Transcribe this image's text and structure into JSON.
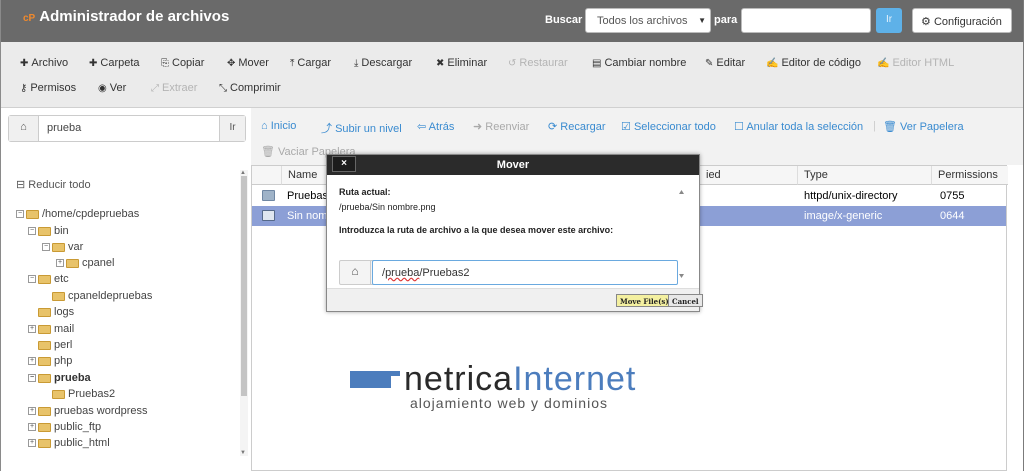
{
  "app": {
    "brand_mark": "cP",
    "title": "Administrador de archivos"
  },
  "search": {
    "label": "Buscar",
    "scope": "Todos los archivos",
    "para_label": "para",
    "query": "",
    "go": "Ir"
  },
  "settings_label": "Configuración",
  "toolbar": {
    "row1": [
      "Archivo",
      "Carpeta",
      "Copiar",
      "Mover",
      "Cargar",
      "Descargar",
      "Eliminar",
      "Restaurar",
      "Cambiar nombre",
      "Editar",
      "Editor de código",
      "Editor HTML"
    ],
    "row2": [
      "Permisos",
      "Ver",
      "Extraer",
      "Comprimir"
    ]
  },
  "left": {
    "path_value": "prueba",
    "go": "Ir",
    "collapse_all": "Reducir todo",
    "tree": [
      "/home/cpdepruebas",
      "bin",
      "var",
      "cpanel",
      "etc",
      "cpaneldepruebas",
      "logs",
      "mail",
      "perl",
      "php",
      "prueba",
      "Pruebas2",
      "pruebas wordpress",
      "public_ftp",
      "public_html"
    ]
  },
  "nav": {
    "home": "Inicio",
    "up": "Subir un nivel",
    "back": "Atrás",
    "forward": "Reenviar",
    "reload": "Recargar",
    "select_all": "Seleccionar todo",
    "unselect": "Anular toda la selección",
    "view_trash": "Ver Papelera",
    "empty_trash": "Vaciar Papelera"
  },
  "table": {
    "headers": {
      "name": "Name",
      "modified": "ied",
      "type": "Type",
      "perms": "Permissions"
    },
    "rows": [
      {
        "name": "Pruebas",
        "type": "httpd/unix-directory",
        "perms": "0755"
      },
      {
        "name": "Sin nom",
        "type": "image/x-generic",
        "perms": "0644"
      }
    ]
  },
  "dialog": {
    "close": "×",
    "title": "Mover",
    "current_label": "Ruta actual:",
    "current_path": "/prueba/Sin nombre.png",
    "prompt": "Introduzca la ruta de archivo a la que desea mover este archivo:",
    "path_prefix": "/",
    "path_word": "prueba",
    "path_rest": "/Pruebas2",
    "move_button": "Move File(s)",
    "cancel_button": "Cancel"
  },
  "logo": {
    "name_dark": "netrica",
    "name_blue": "Internet",
    "tagline": "alojamiento web y dominios"
  },
  "colors": {
    "header_bg": "#6a6a6a",
    "link_blue": "#3a8bd0",
    "selected_row": "#8c9fd6",
    "dialog_title_bg": "#2b2b2b",
    "logo_blue": "#4c7dbd"
  }
}
